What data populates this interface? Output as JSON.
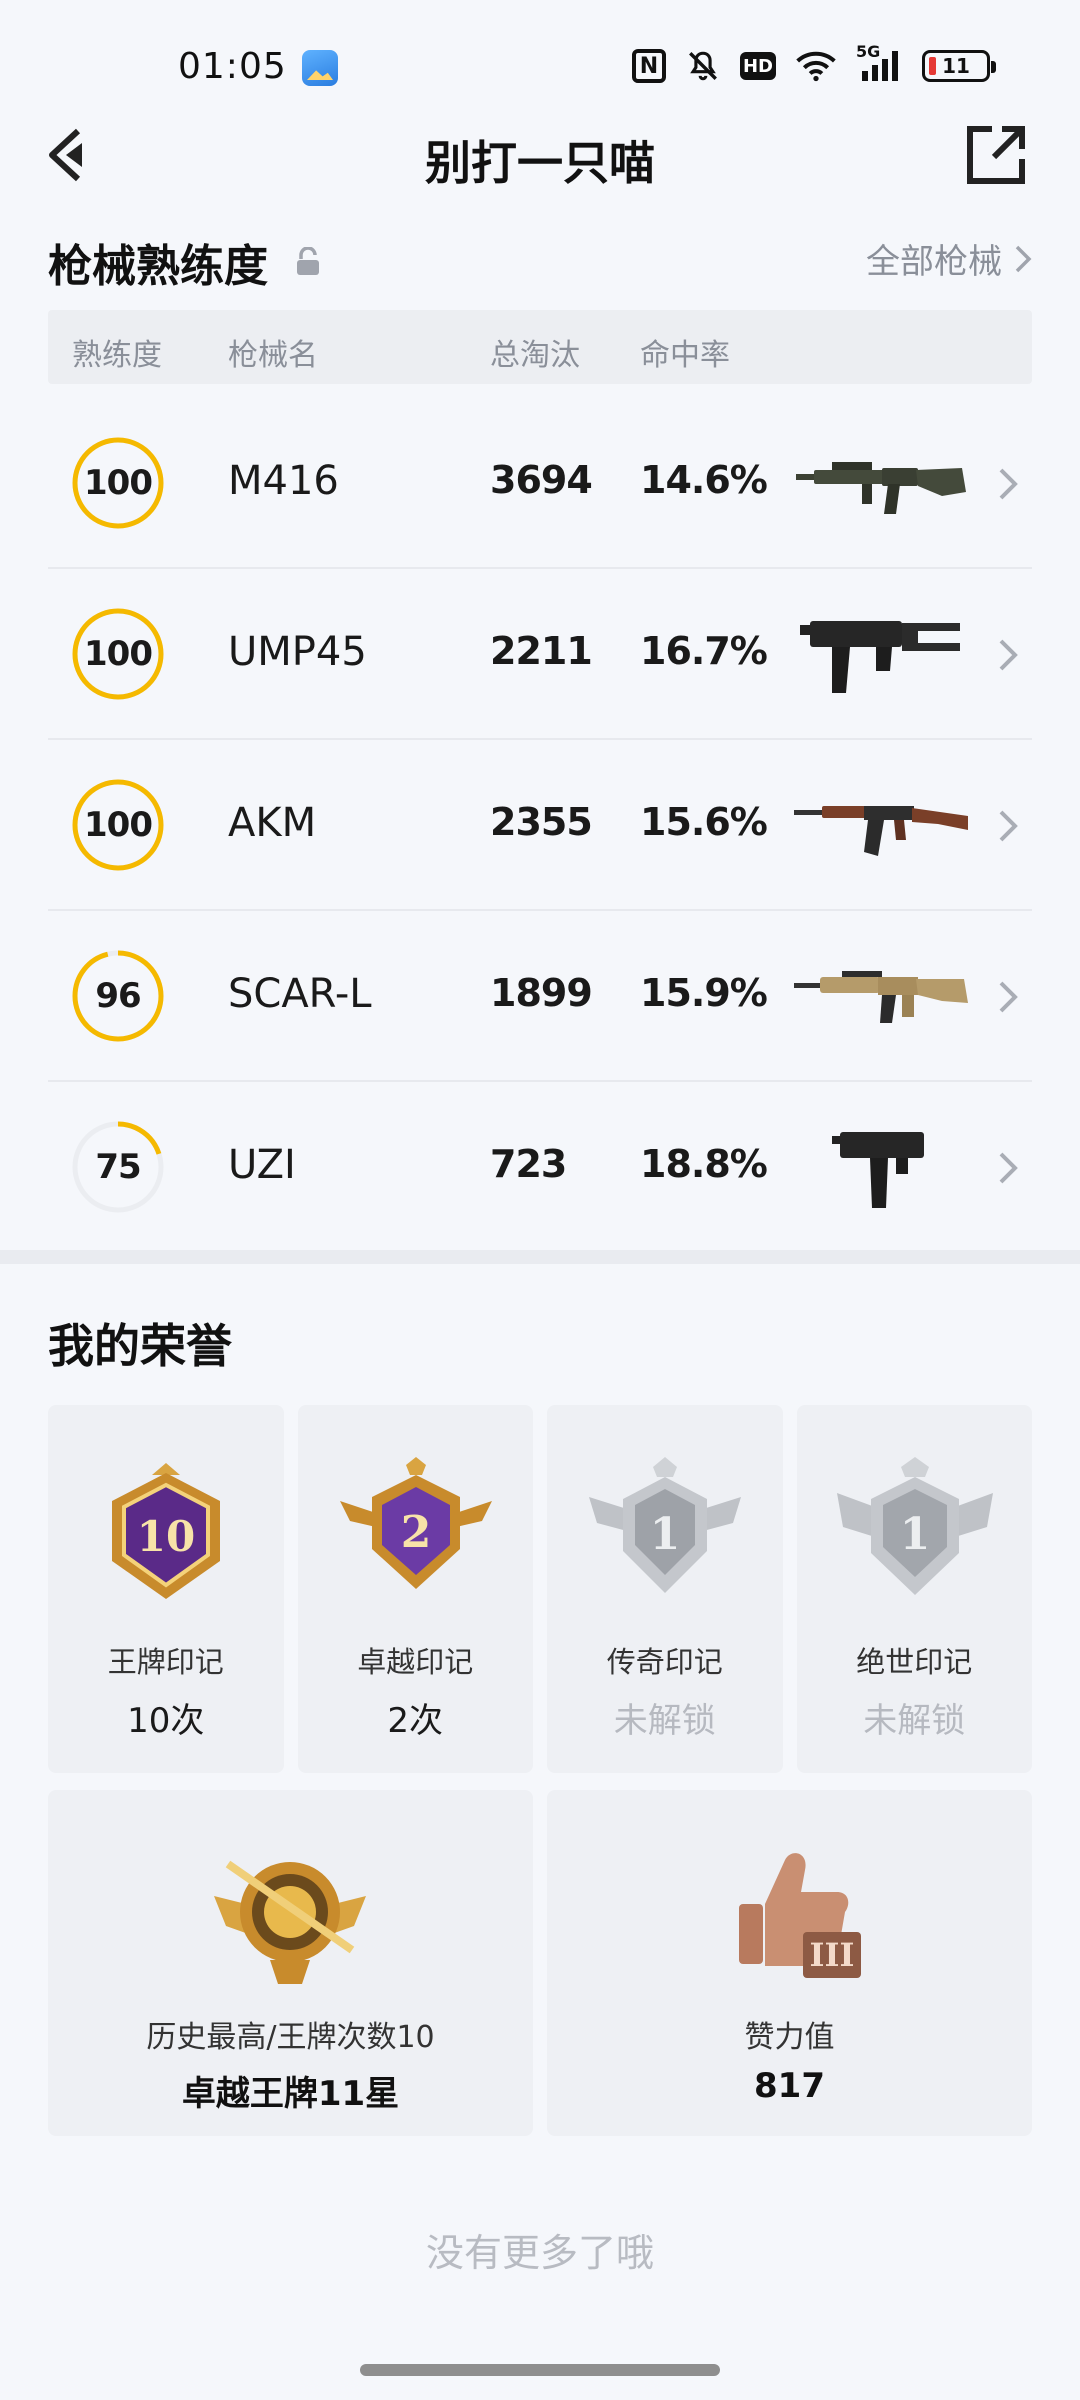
{
  "status_bar": {
    "time": "01:05",
    "icons": [
      "gallery-icon",
      "nfc-icon",
      "mute-icon",
      "hd-icon",
      "wifi-icon",
      "signal-5g-icon",
      "battery-icon"
    ],
    "hd_label": "HD",
    "nfc_label": "N",
    "signal_label": "5G",
    "battery_level": "11"
  },
  "header": {
    "title": "别打一只喵",
    "back_icon": "back-icon",
    "share_icon": "share-icon"
  },
  "weapons": {
    "section_title": "枪械熟练度",
    "all_link": "全部枪械",
    "columns": [
      "熟练度",
      "枪械名",
      "总淘汰",
      "命中率"
    ],
    "rows": [
      {
        "level": "100",
        "progress": 1.0,
        "name": "M416",
        "kills": "3694",
        "rate": "14.6%"
      },
      {
        "level": "100",
        "progress": 1.0,
        "name": "UMP45",
        "kills": "2211",
        "rate": "16.7%"
      },
      {
        "level": "100",
        "progress": 1.0,
        "name": "AKM",
        "kills": "2355",
        "rate": "15.6%"
      },
      {
        "level": "96",
        "progress": 0.96,
        "name": "SCAR-L",
        "kills": "1899",
        "rate": "15.9%"
      },
      {
        "level": "75",
        "progress": 0.2,
        "name": "UZI",
        "kills": "723",
        "rate": "18.8%"
      }
    ]
  },
  "honors": {
    "section_title": "我的荣誉",
    "badges": [
      {
        "label": "王牌印记",
        "value": "10次",
        "number": "10",
        "locked": false
      },
      {
        "label": "卓越印记",
        "value": "2次",
        "number": "2",
        "locked": false
      },
      {
        "label": "传奇印记",
        "value": "未解锁",
        "number": "1",
        "locked": true
      },
      {
        "label": "绝世印记",
        "value": "未解锁",
        "number": "1",
        "locked": true
      }
    ],
    "stats": [
      {
        "label": "历史最高/王牌次数10",
        "value": "卓越王牌11星"
      },
      {
        "label": "赞力值",
        "value": "817",
        "rank_numeral": "III"
      }
    ]
  },
  "footer": {
    "text": "没有更多了哦"
  },
  "colors": {
    "ring_active": "#f5b900",
    "ring_track": "#ebedf1",
    "muted_text": "#8a8f99"
  }
}
